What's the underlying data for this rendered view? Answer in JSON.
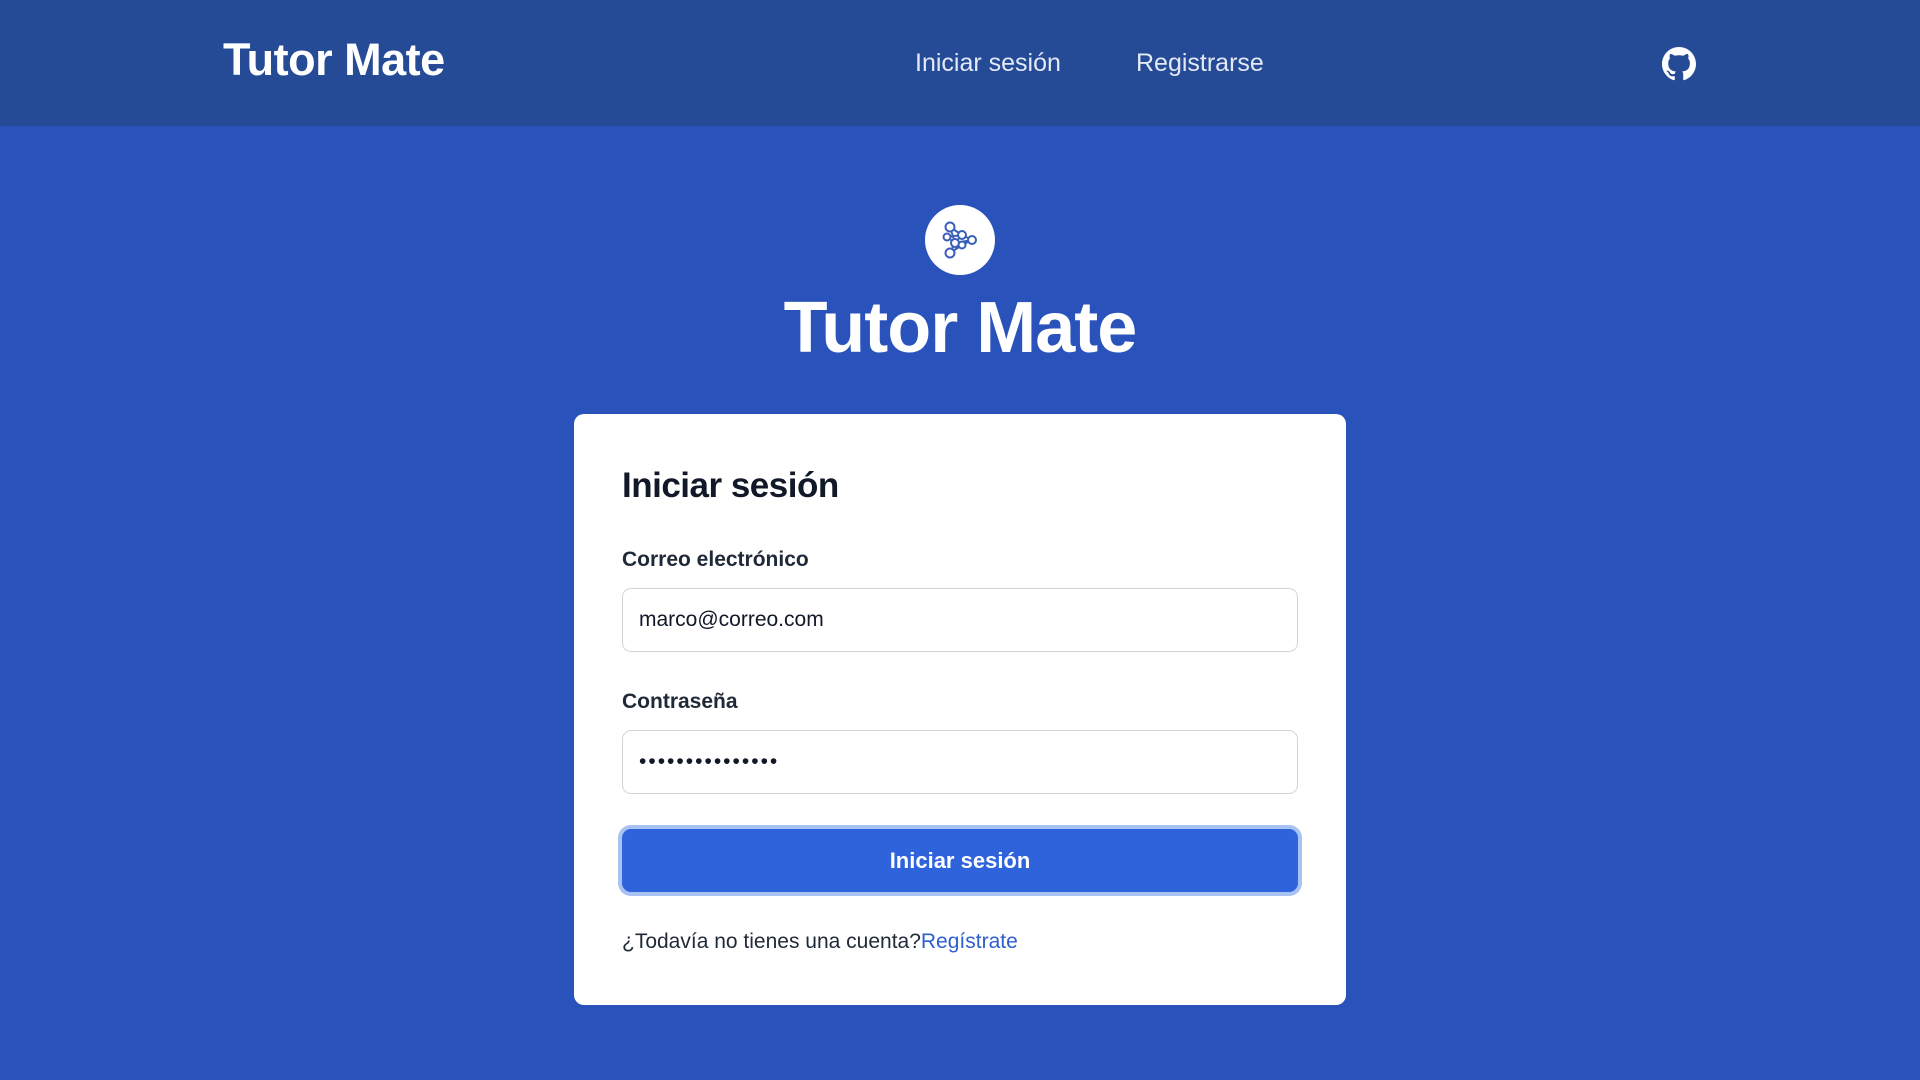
{
  "header": {
    "brand": "Tutor Mate",
    "nav": {
      "login": "Iniciar sesión",
      "register": "Registrarse"
    },
    "github_icon": "github-icon"
  },
  "hero": {
    "logo_icon": "network-graph-icon",
    "title": "Tutor Mate"
  },
  "login_form": {
    "title": "Iniciar sesión",
    "email_label": "Correo electrónico",
    "email_value": "marco@correo.com",
    "password_label": "Contraseña",
    "password_value": "•••••••••••••••",
    "submit_label": "Iniciar sesión",
    "signup_prompt": "¿Todavía no tienes una cuenta?",
    "signup_link": "Regístrate"
  },
  "colors": {
    "page_background": "#2953ba",
    "header_background": "#264b96",
    "primary_button": "#2e63dc",
    "link": "#2e5fcf"
  }
}
